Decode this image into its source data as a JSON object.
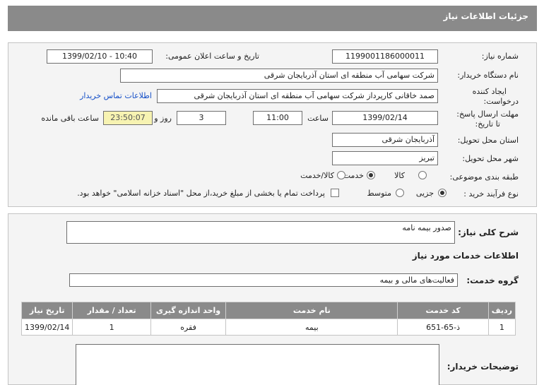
{
  "page_title": "جزئیات اطلاعات نیاز",
  "form": {
    "need_number_label": "شماره نیاز:",
    "need_number": "1199001186000011",
    "announce_label": "تاریخ و ساعت اعلان عمومی:",
    "announce_value": "1399/02/10 - 10:40",
    "buyer_org_label": "نام دستگاه خریدار:",
    "buyer_org": "شرکت سهامی آب منطقه ای استان آذربایجان شرقی",
    "requester_label_1": "ایجاد کننده",
    "requester_label_2": "درخواست:",
    "requester": "صمد خاقانی کارپرداز شرکت سهامی آب منطقه ای استان آذربایجان شرقی",
    "contact_link": "اطلاعات تماس خریدار",
    "deadline_label_1": "مهلت ارسال پاسخ:",
    "deadline_label_2": "تا تاریخ:",
    "deadline_date": "1399/02/14",
    "time_label": "ساعت",
    "deadline_time": "11:00",
    "days_value": "3",
    "days_label": "روز و",
    "remaining_time": "23:50:07",
    "remaining_label": "ساعت باقی مانده",
    "province_label": "استان محل تحویل:",
    "province": "آذربایجان شرقی",
    "city_label": "شهر محل تحویل:",
    "city": "تبریز",
    "category_label": "طبقه بندی موضوعی:",
    "category_options": [
      "کالا",
      "خدمت",
      "کالا/خدمت"
    ],
    "category_selected": "خدمت",
    "process_label": "نوع فرآیند خرید :",
    "process_options": [
      "جزیی",
      "متوسط"
    ],
    "process_selected": "جزیی",
    "payment_note": "پرداخت تمام یا بخشی از مبلغ خرید،از محل \"اسناد خزانه اسلامی\" خواهد بود."
  },
  "details": {
    "summary_label": "شرح کلی نیاز:",
    "summary": "صدور بیمه نامه",
    "services_title": "اطلاعات خدمات مورد نیاز",
    "service_group_label": "گروه خدمت:",
    "service_group": "فعالیت‌های مالی و بیمه",
    "table_headers": [
      "ردیف",
      "کد خدمت",
      "نام خدمت",
      "واحد اندازه گیری",
      "تعداد / مقدار",
      "تاریخ نیاز"
    ],
    "table_rows": [
      {
        "row": "1",
        "code": "ذ-65-651",
        "name": "بیمه",
        "unit": "فقره",
        "qty": "1",
        "date": "1399/02/14"
      }
    ],
    "buyer_notes_label": "توضیحات خریدار:",
    "buyer_notes": ""
  },
  "icons": {
    "radio": "radio-icon",
    "checkbox": "checkbox-icon"
  }
}
